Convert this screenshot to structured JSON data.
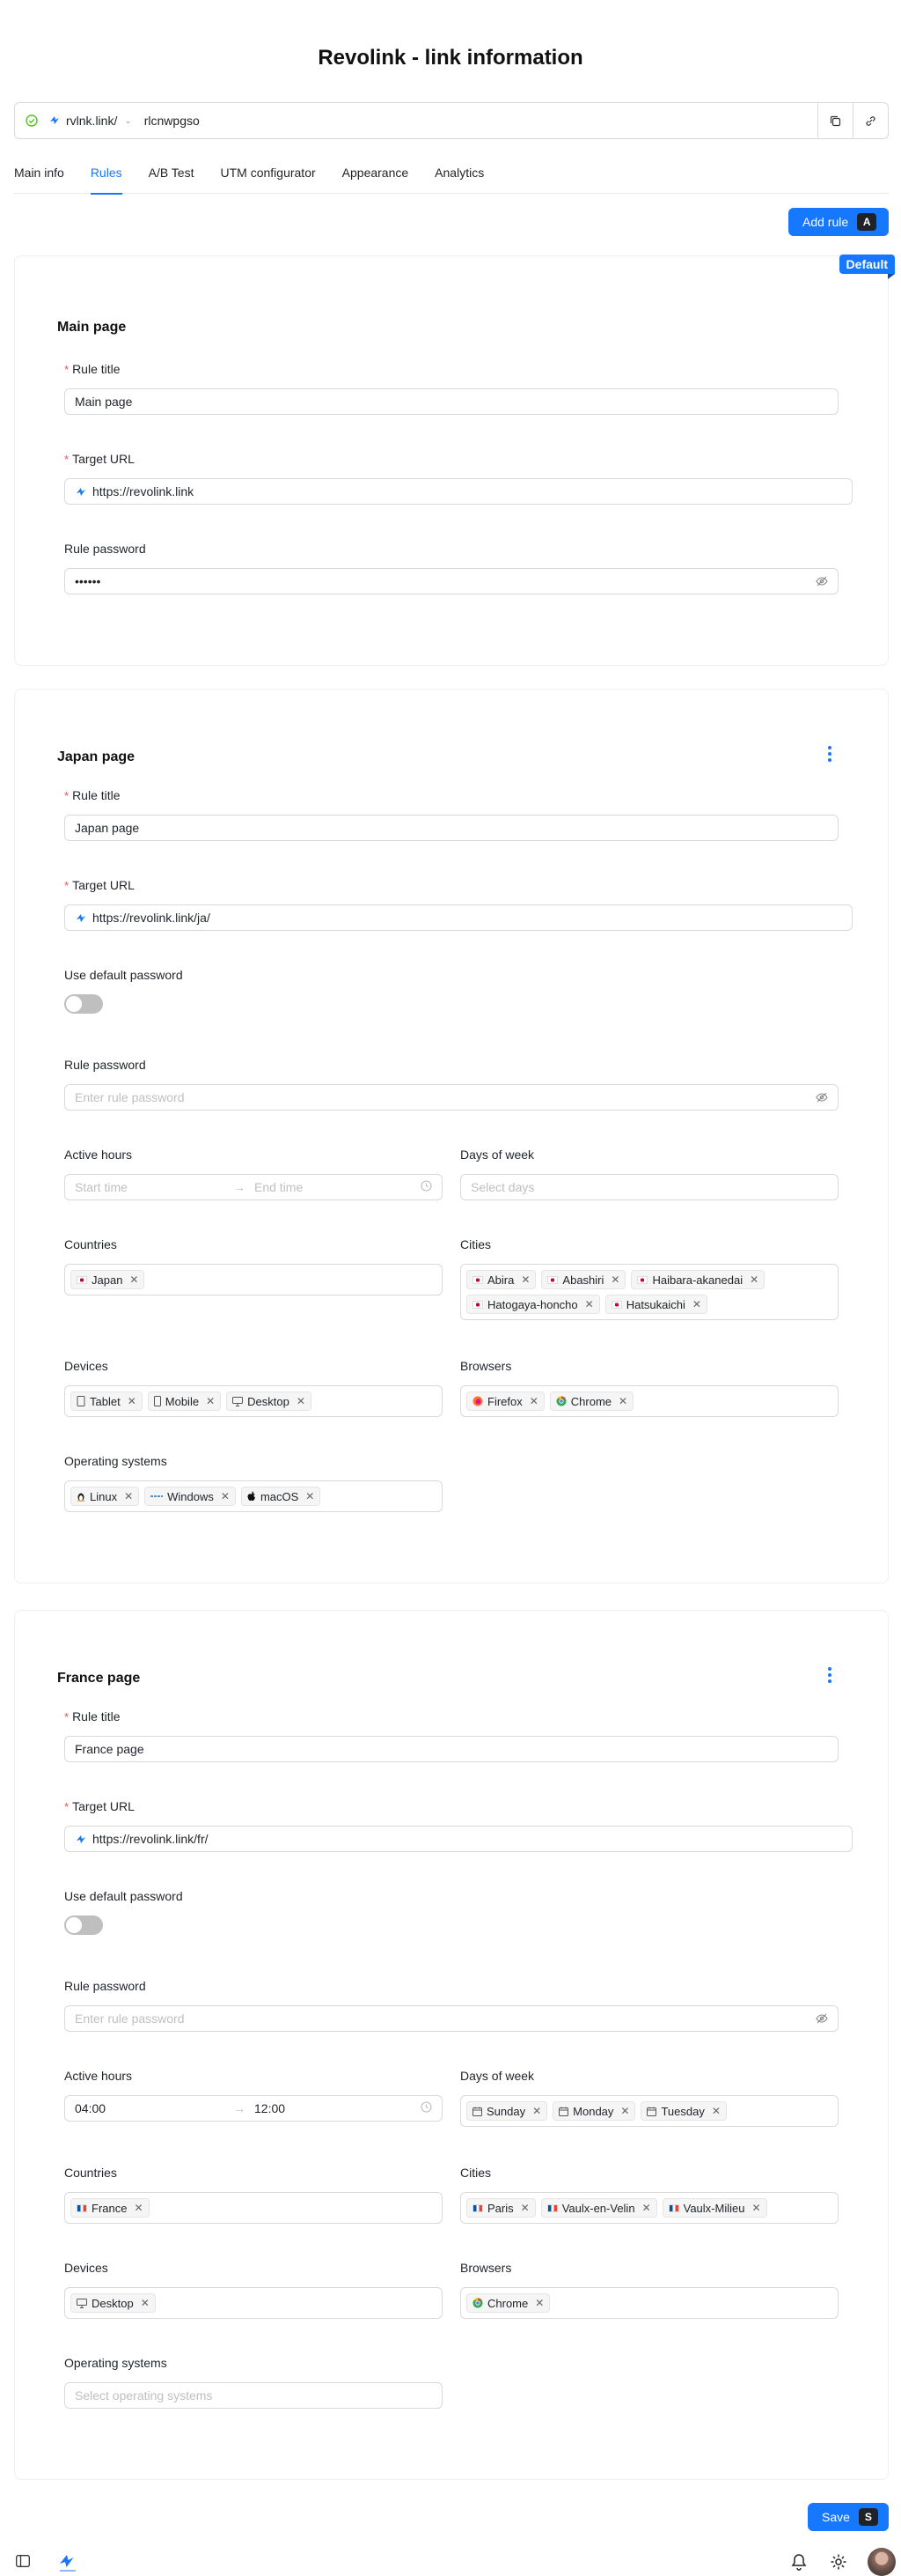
{
  "title": "Revolink - link information",
  "url_bar": {
    "domain": "rvlnk.link/",
    "slug": "rlcnwpgso"
  },
  "tabs": [
    "Main info",
    "Rules",
    "A/B Test",
    "UTM configurator",
    "Appearance",
    "Analytics"
  ],
  "active_tab": "Rules",
  "add_rule": {
    "label": "Add rule",
    "shortcut": "A"
  },
  "save": {
    "label": "Save",
    "shortcut": "S"
  },
  "labels": {
    "rule_title": "Rule title",
    "target_url": "Target URL",
    "rule_password": "Rule password",
    "use_default_password": "Use default password",
    "active_hours": "Active hours",
    "days_of_week": "Days of week",
    "countries": "Countries",
    "cities": "Cities",
    "devices": "Devices",
    "browsers": "Browsers",
    "operating_systems": "Operating systems"
  },
  "placeholders": {
    "password": "Enter rule password",
    "start_time": "Start time",
    "end_time": "End time",
    "days": "Select days",
    "os": "Select operating systems"
  },
  "rules": [
    {
      "name": "Main page",
      "badge": "Default",
      "title": "Main page",
      "target_url": "https://revolink.link",
      "password_mask": "••••••"
    },
    {
      "name": "Japan page",
      "title": "Japan page",
      "target_url": "https://revolink.link/ja/",
      "countries": [
        "Japan"
      ],
      "cities": [
        "Abira",
        "Abashiri",
        "Haibara-akanedai",
        "Hatogaya-honcho",
        "Hatsukaichi"
      ],
      "devices": [
        "Tablet",
        "Mobile",
        "Desktop"
      ],
      "browsers": [
        "Firefox",
        "Chrome"
      ],
      "operating_systems": [
        "Linux",
        "Windows",
        "macOS"
      ]
    },
    {
      "name": "France page",
      "title": "France page",
      "target_url": "https://revolink.link/fr/",
      "start_time": "04:00",
      "end_time": "12:00",
      "days": [
        "Sunday",
        "Monday",
        "Tuesday"
      ],
      "countries": [
        "France"
      ],
      "cities": [
        "Paris",
        "Vaulx-en-Velin",
        "Vaulx-Milieu"
      ],
      "devices": [
        "Desktop"
      ],
      "browsers": [
        "Chrome"
      ]
    }
  ],
  "colors": {
    "accent": "#1677ff",
    "required": "#ff4d4f",
    "success": "#52c41a"
  }
}
